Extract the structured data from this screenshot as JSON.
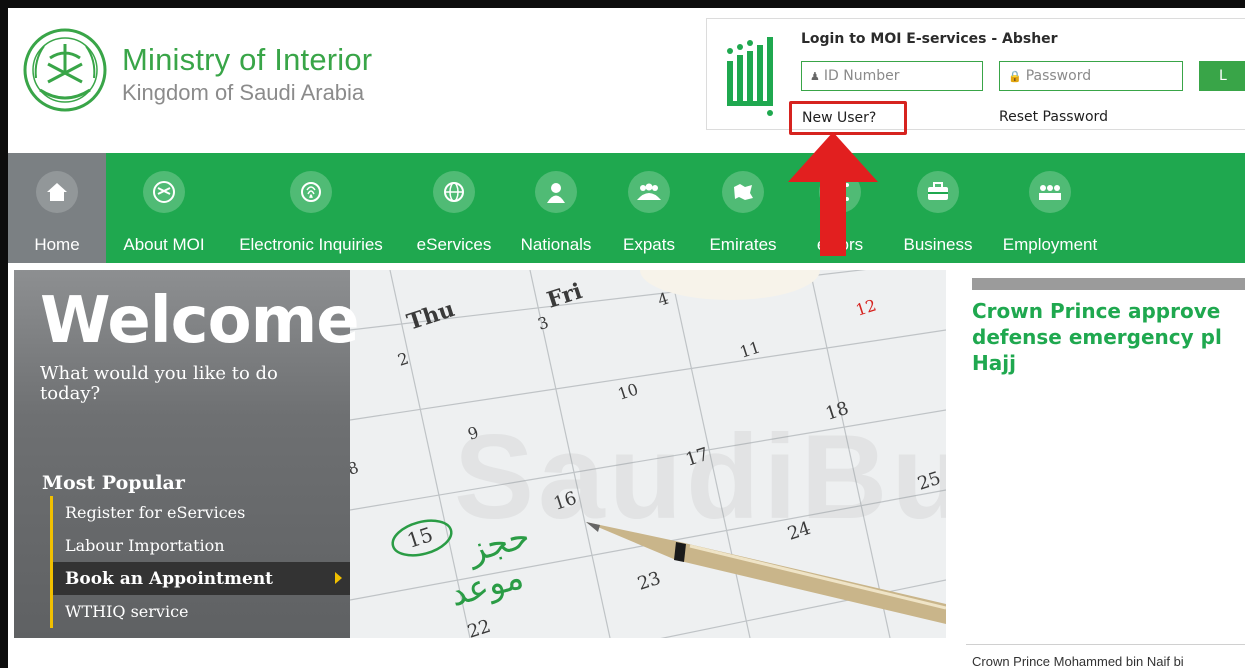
{
  "header": {
    "title": "Ministry of Interior",
    "subtitle": "Kingdom of Saudi Arabia"
  },
  "login": {
    "title": "Login to MOI E-services - Absher",
    "id_placeholder": "ID Number",
    "password_placeholder": "Password",
    "login_label": "L",
    "new_user": "New User?",
    "reset_password": "Reset Password"
  },
  "nav": {
    "items": [
      {
        "label": "Home",
        "icon": "home-icon"
      },
      {
        "label": "About MOI",
        "icon": "emblem-icon"
      },
      {
        "label": "Electronic Inquiries",
        "icon": "globe-fingerprint-icon"
      },
      {
        "label": "eServices",
        "icon": "globe-icon"
      },
      {
        "label": "Nationals",
        "icon": "person-icon"
      },
      {
        "label": "Expats",
        "icon": "group-icon"
      },
      {
        "label": "Emirates",
        "icon": "map-icon"
      },
      {
        "label": "ectors",
        "icon": "network-icon"
      },
      {
        "label": "Business",
        "icon": "briefcase-icon"
      },
      {
        "label": "Employment",
        "icon": "team-icon"
      }
    ]
  },
  "hero": {
    "welcome": "Welcome",
    "welcome_sub": "What would you like to do today?",
    "popular_title": "Most Popular",
    "popular": [
      {
        "label": "Register for eServices"
      },
      {
        "label": "Labour Importation"
      },
      {
        "label": "Book an Appointment"
      },
      {
        "label": "WTHIQ service"
      }
    ],
    "watermark": "SaudiBuzz",
    "calendar": {
      "days": [
        "Thu",
        "Fri"
      ],
      "numbers": [
        "2",
        "3",
        "4",
        "8",
        "9",
        "10",
        "11",
        "12",
        "15",
        "16",
        "17",
        "18",
        "22",
        "23",
        "24",
        "25"
      ],
      "arabic_text": [
        "حجز",
        "موعد"
      ]
    }
  },
  "news": {
    "headline": "Crown Prince approve\ndefense emergency pl\nHajj",
    "caption": "Crown Prince Mohammed bin Naif bi"
  },
  "colors": {
    "brand_green": "#1fa84f",
    "highlight_red": "#d6231f",
    "accent_yellow": "#f1c000"
  }
}
